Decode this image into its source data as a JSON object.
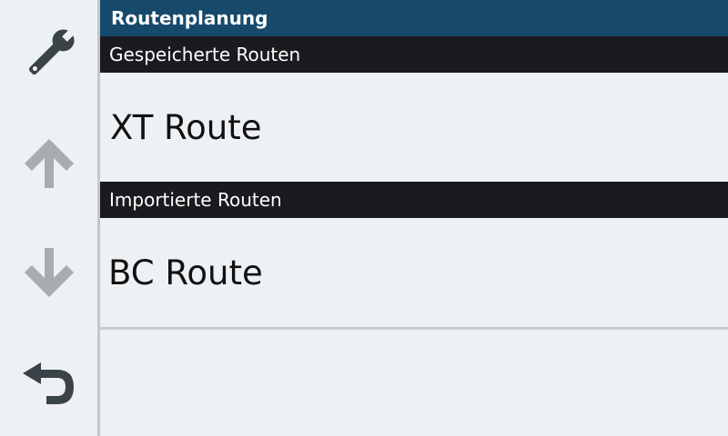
{
  "sidebar": {
    "buttons": [
      {
        "icon": "wrench-icon",
        "color": "#3a4448"
      },
      {
        "icon": "arrow-up-icon",
        "color": "#a6acaf"
      },
      {
        "icon": "arrow-down-icon",
        "color": "#a6acaf"
      },
      {
        "icon": "back-icon",
        "color": "#3a4448"
      }
    ]
  },
  "header": {
    "title": "Routenplanung"
  },
  "sections": [
    {
      "label": "Gespeicherte Routen",
      "items": [
        {
          "label": "XT Route"
        }
      ]
    },
    {
      "label": "Importierte Routen",
      "items": [
        {
          "label": "BC Route"
        }
      ]
    }
  ],
  "colors": {
    "title_bar": "#17496b",
    "section_header": "#1b1b1f",
    "background": "#eef1f4"
  }
}
